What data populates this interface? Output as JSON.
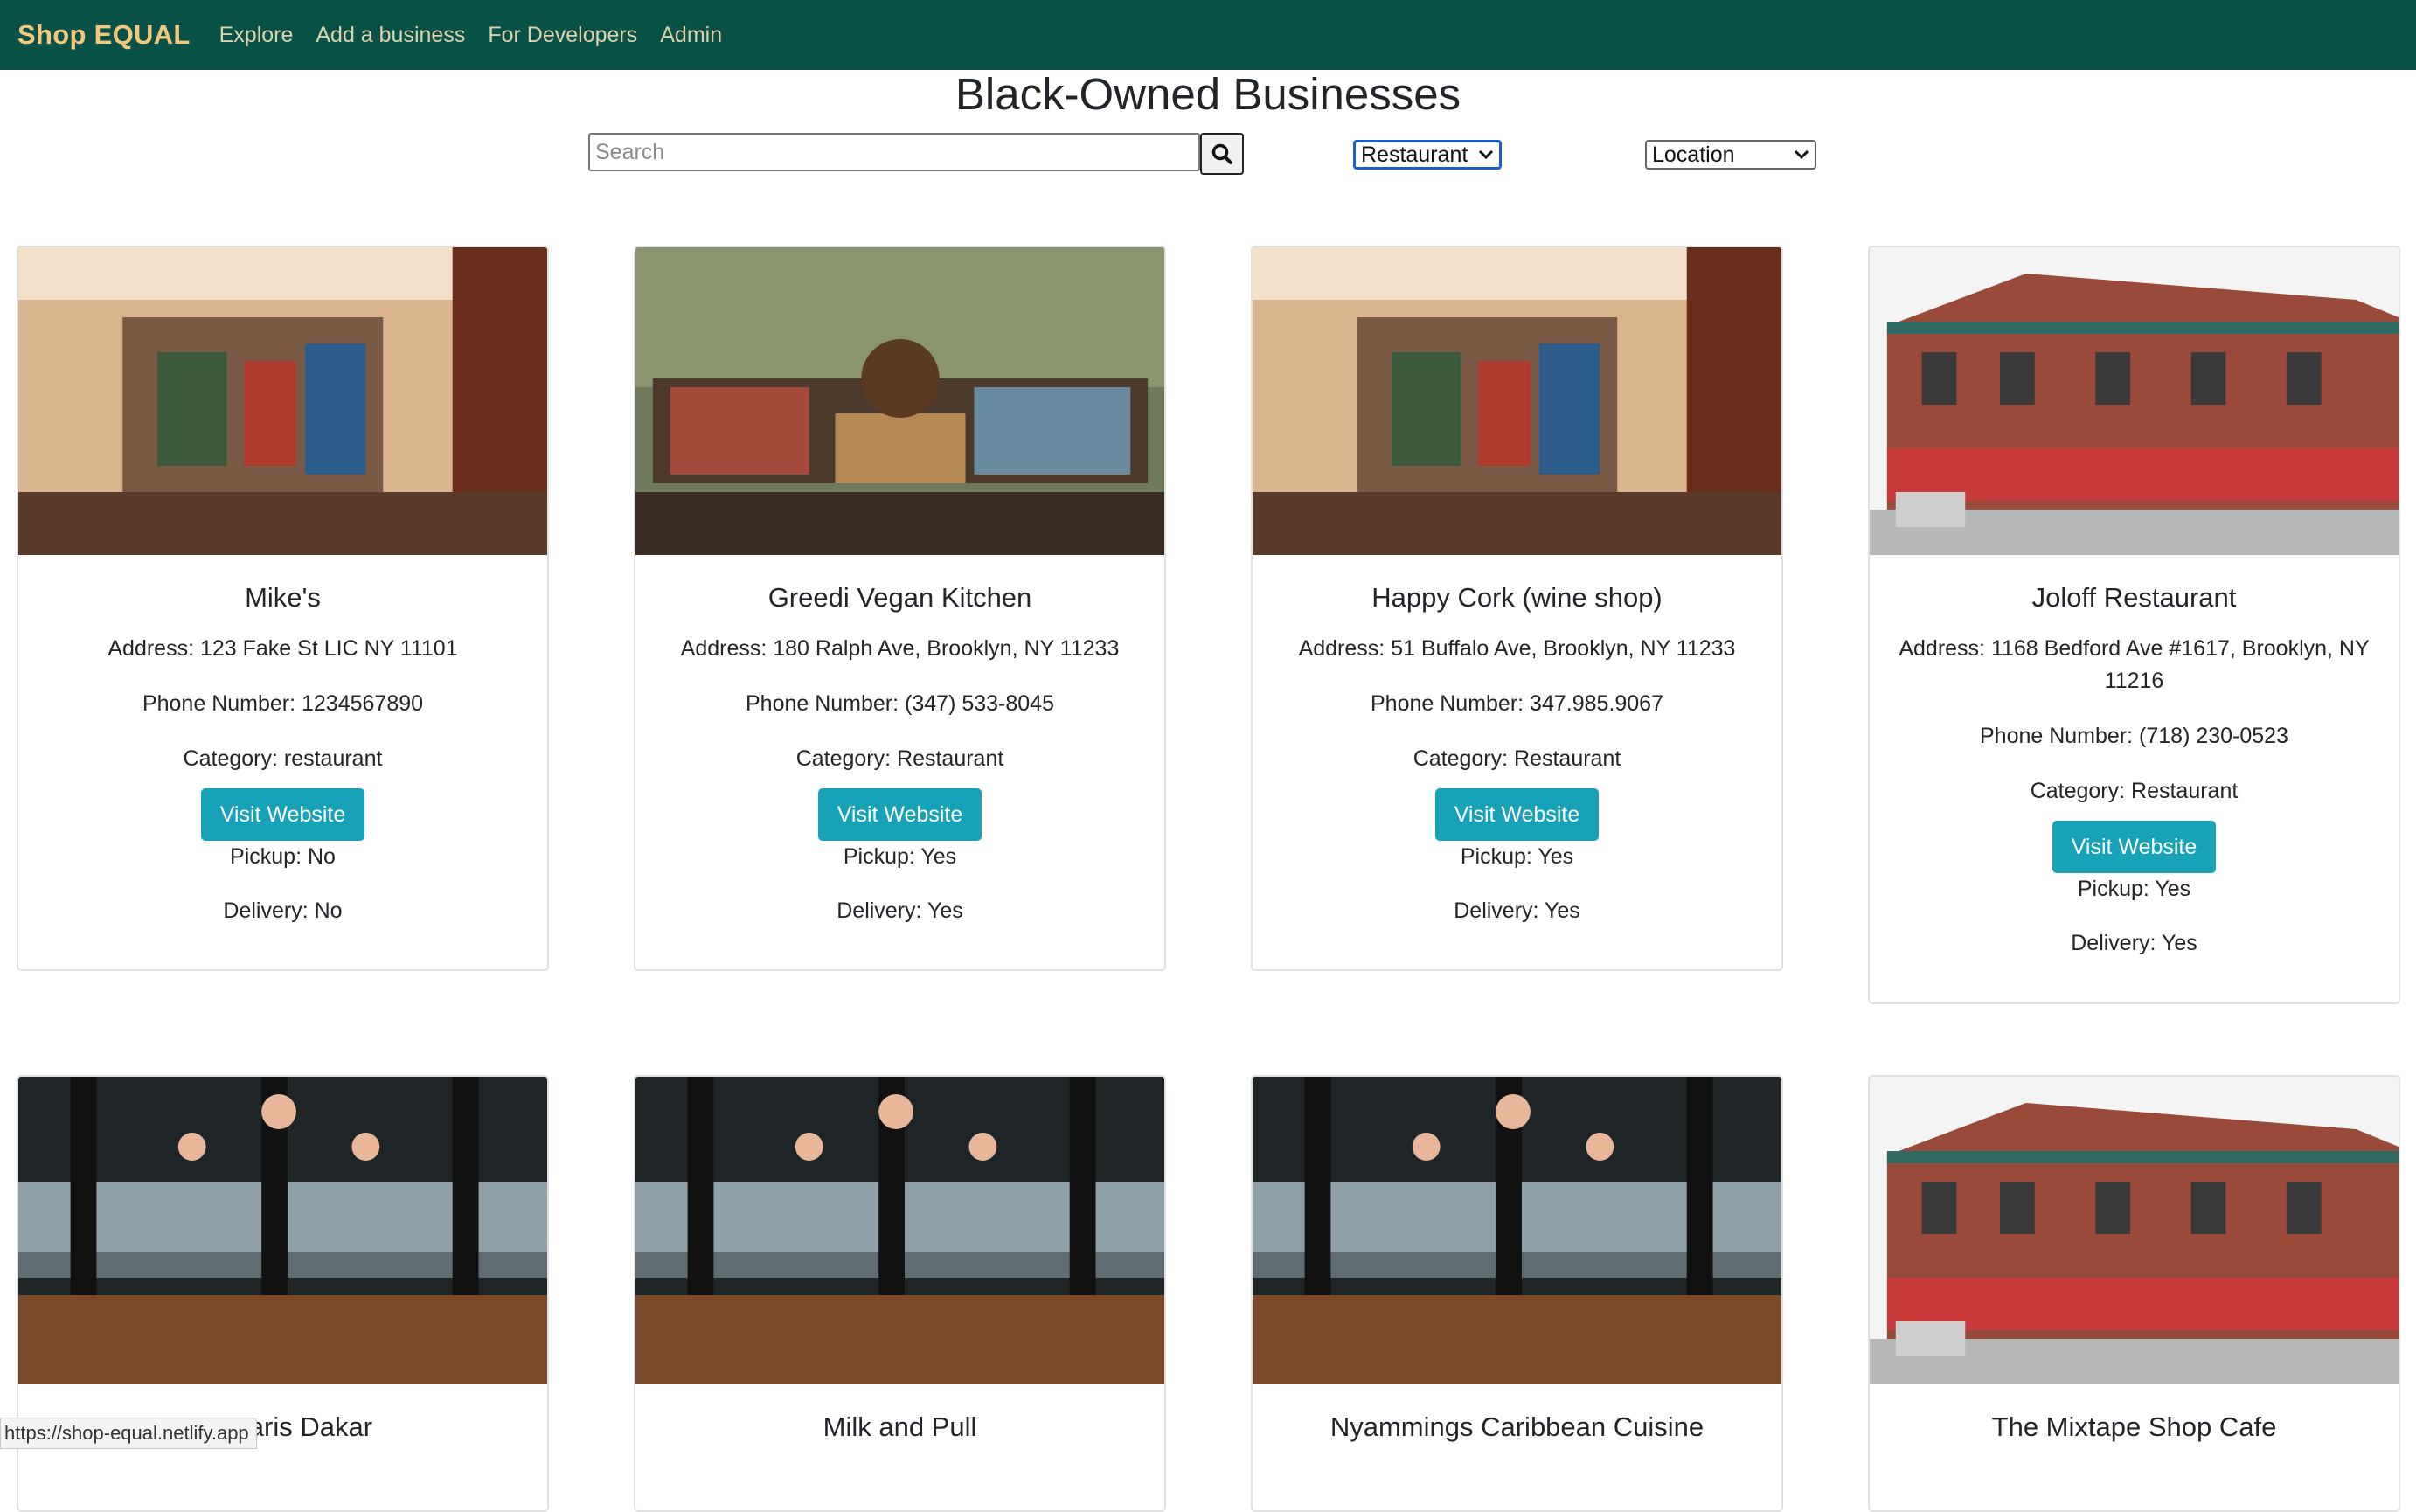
{
  "navbar": {
    "brand": "Shop EQUAL",
    "links": [
      "Explore",
      "Add a business",
      "For Developers",
      "Admin"
    ]
  },
  "page": {
    "title": "Black-Owned Businesses",
    "search_placeholder": "Search",
    "category_selected": "Restaurant",
    "location_selected": "Location"
  },
  "cards": [
    {
      "name": "Mike's",
      "address": "Address: 123 Fake St LIC NY 11101",
      "phone": "Phone Number: 1234567890",
      "category": "Category: restaurant",
      "button": "Visit Website",
      "pickup": "Pickup: No",
      "delivery": "Delivery: No",
      "image": "clothing-store-photo"
    },
    {
      "name": "Greedi Vegan Kitchen",
      "address": "Address: 180 Ralph Ave, Brooklyn, NY 11233",
      "phone": "Phone Number: (347) 533-8045",
      "category": "Category: Restaurant",
      "button": "Visit Website",
      "pickup": "Pickup: Yes",
      "delivery": "Delivery: Yes",
      "image": "boutique-leaf-wallpaper-photo"
    },
    {
      "name": "Happy Cork (wine shop)",
      "address": "Address: 51 Buffalo Ave, Brooklyn, NY 11233",
      "phone": "Phone Number: 347.985.9067",
      "category": "Category: Restaurant",
      "button": "Visit Website",
      "pickup": "Pickup: Yes",
      "delivery": "Delivery: Yes",
      "image": "clothing-store-photo"
    },
    {
      "name": "Joloff Restaurant",
      "address": "Address: 1168 Bedford Ave #1617, Brooklyn, NY 11216",
      "phone": "Phone Number: (718) 230-0523",
      "category": "Category: Restaurant",
      "button": "Visit Website",
      "pickup": "Pickup: Yes",
      "delivery": "Delivery: Yes",
      "image": "brick-building-photo"
    },
    {
      "name": "Le Paris Dakar",
      "image": "dining-room-photo"
    },
    {
      "name": "Milk and Pull",
      "image": "dining-room-photo"
    },
    {
      "name": "Nyammings Caribbean Cuisine",
      "image": "dining-room-photo"
    },
    {
      "name": "The Mixtape Shop Cafe",
      "image": "brick-building-photo"
    }
  ],
  "status_bar": {
    "url": "https://shop-equal.netlify.app"
  },
  "colors": {
    "navbar": "#0a5148",
    "brand": "#f3c879",
    "button": "#17a2b8"
  }
}
